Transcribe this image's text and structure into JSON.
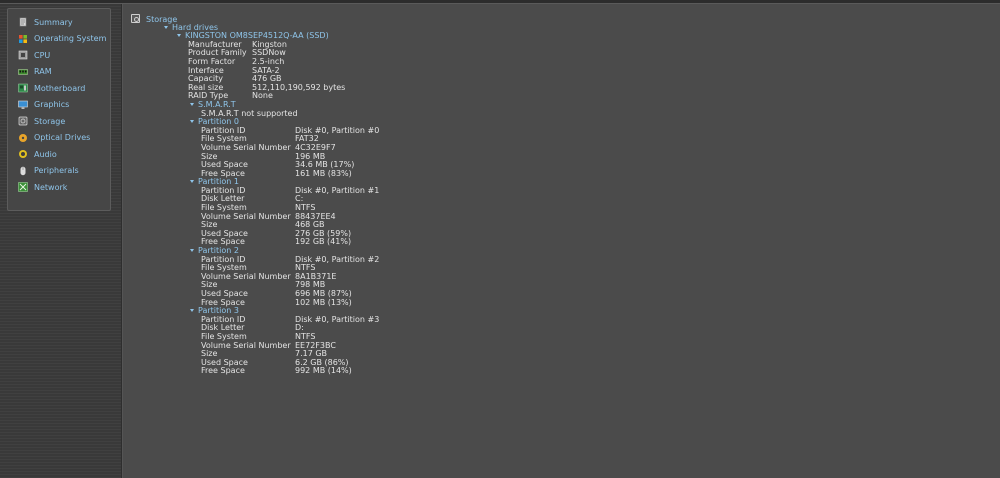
{
  "sidebar": {
    "items": [
      {
        "label": "Summary",
        "icon": "summary-icon"
      },
      {
        "label": "Operating System",
        "icon": "windows-logo-icon"
      },
      {
        "label": "CPU",
        "icon": "cpu-icon"
      },
      {
        "label": "RAM",
        "icon": "ram-icon"
      },
      {
        "label": "Motherboard",
        "icon": "motherboard-icon"
      },
      {
        "label": "Graphics",
        "icon": "monitor-icon"
      },
      {
        "label": "Storage",
        "icon": "hard-drive-icon"
      },
      {
        "label": "Optical Drives",
        "icon": "optical-disc-icon"
      },
      {
        "label": "Audio",
        "icon": "speaker-icon"
      },
      {
        "label": "Peripherals",
        "icon": "mouse-icon"
      },
      {
        "label": "Network",
        "icon": "network-icon"
      }
    ]
  },
  "main": {
    "title": "Storage",
    "hard_drives_label": "Hard drives",
    "drive": {
      "name": "KINGSTON OM8SEP4512Q-AA (SSD)",
      "props": [
        {
          "k": "Manufacturer",
          "v": "Kingston"
        },
        {
          "k": "Product Family",
          "v": "SSDNow"
        },
        {
          "k": "Form Factor",
          "v": "2.5-inch"
        },
        {
          "k": "Interface",
          "v": "SATA-2"
        },
        {
          "k": "Capacity",
          "v": "476 GB"
        },
        {
          "k": "Real size",
          "v": "512,110,190,592 bytes"
        },
        {
          "k": "RAID Type",
          "v": "None"
        }
      ],
      "smart_label": "S.M.A.R.T",
      "smart_value": "S.M.A.R.T not supported",
      "partitions": [
        {
          "label": "Partition 0",
          "props": [
            {
              "k": "Partition ID",
              "v": "Disk #0, Partition #0"
            },
            {
              "k": "File System",
              "v": "FAT32"
            },
            {
              "k": "Volume Serial Number",
              "v": "4C32E9F7"
            },
            {
              "k": "Size",
              "v": "196 MB"
            },
            {
              "k": "Used Space",
              "v": "34.6 MB (17%)"
            },
            {
              "k": "Free Space",
              "v": "161 MB (83%)"
            }
          ]
        },
        {
          "label": "Partition 1",
          "props": [
            {
              "k": "Partition ID",
              "v": "Disk #0, Partition #1"
            },
            {
              "k": "Disk Letter",
              "v": "C:"
            },
            {
              "k": "File System",
              "v": "NTFS"
            },
            {
              "k": "Volume Serial Number",
              "v": "88437EE4"
            },
            {
              "k": "Size",
              "v": "468 GB"
            },
            {
              "k": "Used Space",
              "v": "276 GB (59%)"
            },
            {
              "k": "Free Space",
              "v": "192 GB (41%)"
            }
          ]
        },
        {
          "label": "Partition 2",
          "props": [
            {
              "k": "Partition ID",
              "v": "Disk #0, Partition #2"
            },
            {
              "k": "File System",
              "v": "NTFS"
            },
            {
              "k": "Volume Serial Number",
              "v": "8A1B371E"
            },
            {
              "k": "Size",
              "v": "798 MB"
            },
            {
              "k": "Used Space",
              "v": "696 MB (87%)"
            },
            {
              "k": "Free Space",
              "v": "102 MB (13%)"
            }
          ]
        },
        {
          "label": "Partition 3",
          "props": [
            {
              "k": "Partition ID",
              "v": "Disk #0, Partition #3"
            },
            {
              "k": "Disk Letter",
              "v": "D:"
            },
            {
              "k": "File System",
              "v": "NTFS"
            },
            {
              "k": "Volume Serial Number",
              "v": "EE72F3BC"
            },
            {
              "k": "Size",
              "v": "7.17 GB"
            },
            {
              "k": "Used Space",
              "v": "6.2 GB (86%)"
            },
            {
              "k": "Free Space",
              "v": "992 MB (14%)"
            }
          ]
        }
      ]
    }
  },
  "colors": {
    "link": "#8fc5ea",
    "text": "#e4e4e4",
    "background": "#4b4b4b"
  }
}
